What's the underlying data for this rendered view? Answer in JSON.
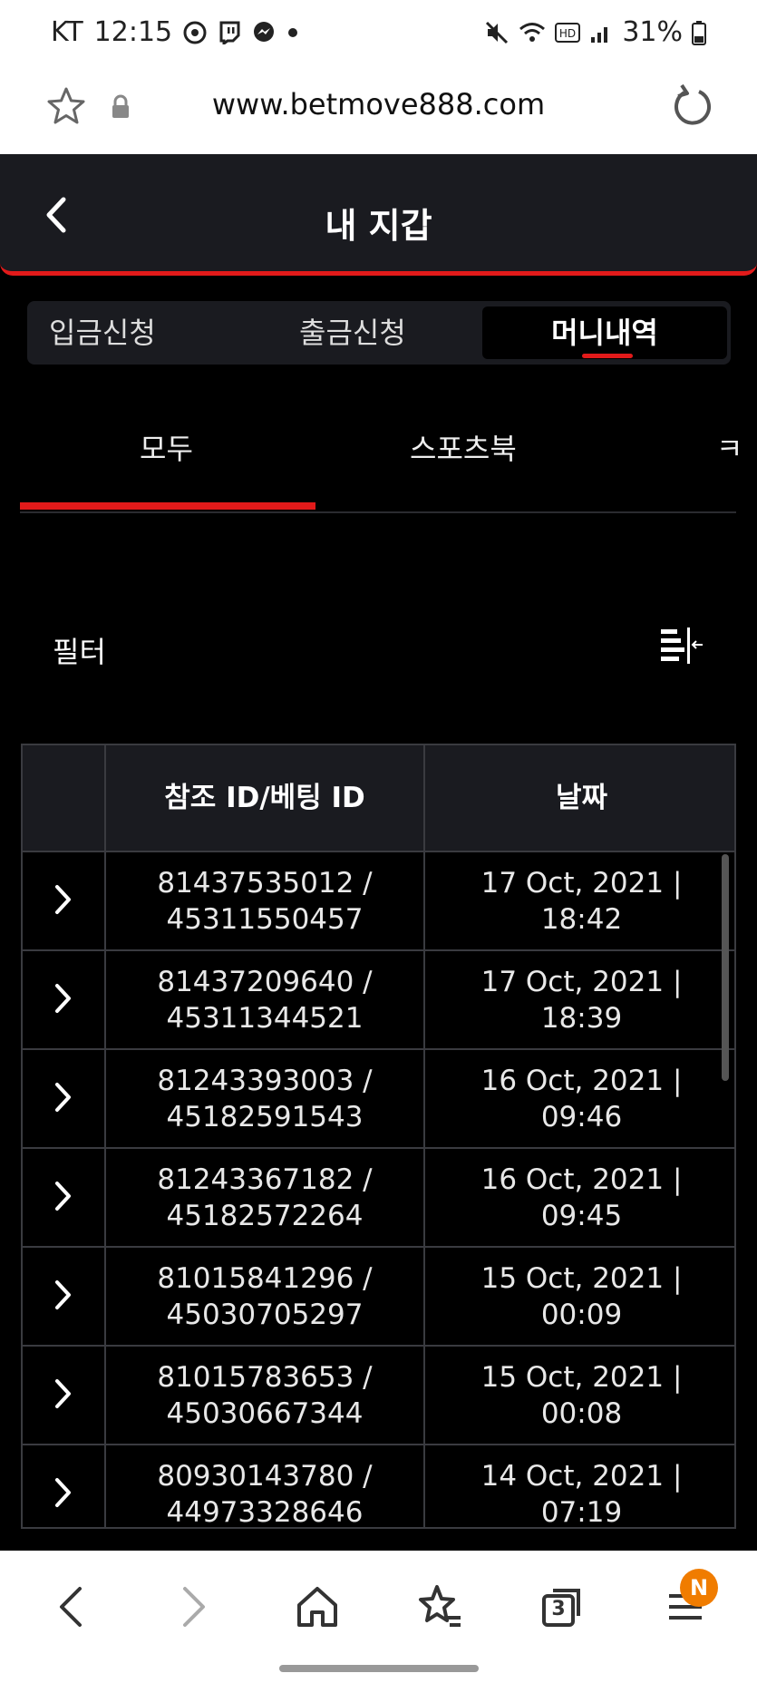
{
  "status_bar": {
    "carrier": "KT",
    "time": "12:15",
    "battery": "31%",
    "icons": [
      "soccer-ball-icon",
      "twitch-icon",
      "messenger-icon",
      "dot-icon",
      "mute-icon",
      "wifi-icon",
      "hd-icon",
      "signal-icon",
      "battery-icon"
    ]
  },
  "browser": {
    "url": "www.betmove888.com"
  },
  "header": {
    "title": "내 지갑"
  },
  "segments": {
    "deposit": "입금신청",
    "withdraw": "출금신청",
    "history": "머니내역"
  },
  "subtabs": {
    "all": "모두",
    "sportsbook": "스포츠북",
    "partial": "ㅋ"
  },
  "filter": {
    "label": "필터"
  },
  "table": {
    "headers": {
      "ref": "참조 ID/베팅 ID",
      "date": "날짜"
    },
    "rows": [
      {
        "ref1": "81437535012 /",
        "ref2": "45311550457",
        "date1": "17 Oct, 2021 |",
        "date2": "18:42"
      },
      {
        "ref1": "81437209640 /",
        "ref2": "45311344521",
        "date1": "17 Oct, 2021 |",
        "date2": "18:39"
      },
      {
        "ref1": "81243393003 /",
        "ref2": "45182591543",
        "date1": "16 Oct, 2021 |",
        "date2": "09:46"
      },
      {
        "ref1": "81243367182 /",
        "ref2": "45182572264",
        "date1": "16 Oct, 2021 |",
        "date2": "09:45"
      },
      {
        "ref1": "81015841296 /",
        "ref2": "45030705297",
        "date1": "15 Oct, 2021 |",
        "date2": "00:09"
      },
      {
        "ref1": "81015783653 /",
        "ref2": "45030667344",
        "date1": "15 Oct, 2021 |",
        "date2": "00:08"
      },
      {
        "ref1": "80930143780 /",
        "ref2": "44973328646",
        "date1": "14 Oct, 2021 |",
        "date2": "07:19"
      }
    ]
  },
  "bottom_nav": {
    "tabs_count": "3",
    "menu_badge": "N"
  },
  "colors": {
    "accent": "#e21a1a",
    "header_bg": "#1a1b20",
    "badge": "#f07c00"
  }
}
